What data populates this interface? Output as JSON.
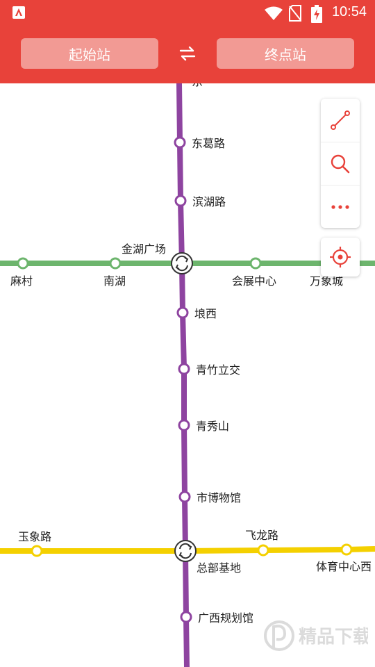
{
  "status_bar": {
    "time": "10:54"
  },
  "header": {
    "start_station_label": "起始站",
    "end_station_label": "终点站",
    "swap_icon": "swap-arrows-icon"
  },
  "toolbox": {
    "route_icon": "route-icon",
    "search_icon": "search-icon",
    "more_icon": "more-dots-icon",
    "locate_icon": "locate-target-icon"
  },
  "colors": {
    "appbar": "#e8423a",
    "purple_line": "#8e44a0",
    "green_line": "#6db56d",
    "yellow_line": "#f4d000",
    "accent_icon": "#e8423a"
  },
  "map": {
    "purple_stations": [
      "东葛路",
      "滨湖路",
      "埌西",
      "青竹立交",
      "青秀山",
      "市博物馆",
      "广西规划馆"
    ],
    "green_stations": [
      "麻村",
      "南湖",
      "会展中心",
      "万象城"
    ],
    "yellow_stations": [
      "玉象路",
      "飞龙路",
      "体育中心西"
    ],
    "interchanges": [
      "金湖广场",
      "总部基地"
    ]
  },
  "watermark": {
    "text": "精品下载"
  }
}
